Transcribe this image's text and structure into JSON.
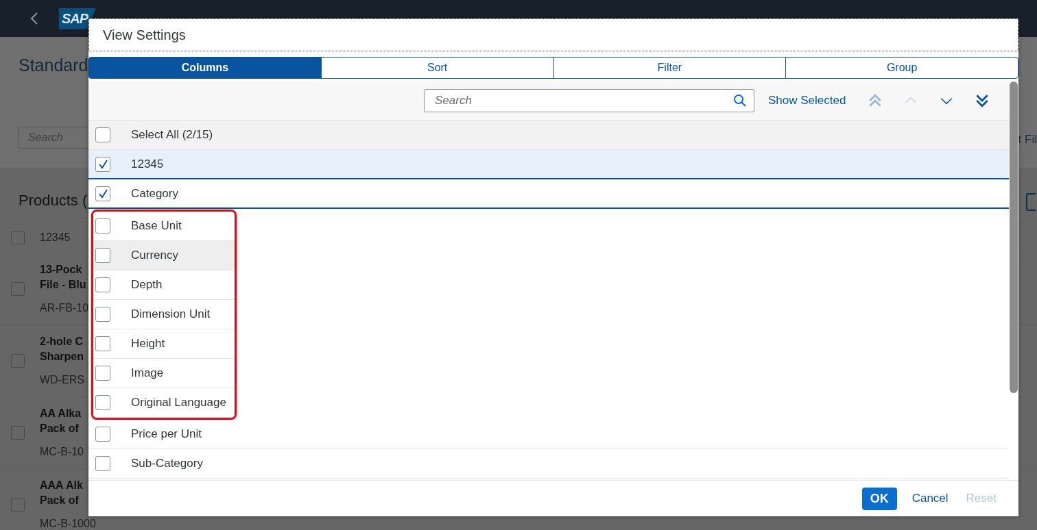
{
  "shell": {
    "logo": "SAP"
  },
  "page": {
    "title": "Standard",
    "search": {
      "placeholder": "Search"
    },
    "side_text": "t Fil"
  },
  "products": {
    "title": "Products (",
    "rows": [
      {
        "kind": "plain",
        "checked": false,
        "lines": [
          "12345"
        ]
      },
      {
        "kind": "item",
        "checked": false,
        "lines": [
          "13-Pock",
          "File - Blu",
          "AR-FB-10"
        ]
      },
      {
        "kind": "item",
        "checked": false,
        "lines": [
          "2-hole C",
          "Sharpen",
          "WD-ERS"
        ]
      },
      {
        "kind": "item",
        "checked": false,
        "lines": [
          "AA Alka",
          "Pack of",
          "MC-B-10"
        ]
      },
      {
        "kind": "item",
        "checked": false,
        "lines": [
          "AAA Alk",
          "Pack of",
          "MC-B-1000"
        ]
      }
    ]
  },
  "dialog": {
    "title": "View Settings",
    "tabs": [
      {
        "label": "Columns",
        "selected": true
      },
      {
        "label": "Sort",
        "selected": false
      },
      {
        "label": "Filter",
        "selected": false
      },
      {
        "label": "Group",
        "selected": false
      }
    ],
    "search": {
      "placeholder": "Search"
    },
    "show_selected": "Show Selected",
    "move_buttons": [
      {
        "kind": "top",
        "disabled": true
      },
      {
        "kind": "up",
        "disabled": true
      },
      {
        "kind": "down",
        "disabled": false
      },
      {
        "kind": "bottom",
        "disabled": false
      }
    ],
    "select_all": {
      "label": "Select All (2/15)",
      "checked": false
    },
    "columns": [
      {
        "label": "12345",
        "checked": true,
        "selected": true,
        "hovered": false,
        "marked": false
      },
      {
        "label": "Category",
        "checked": true,
        "selected": false,
        "hovered": false,
        "marked": false
      },
      {
        "label": "Base Unit",
        "checked": false,
        "selected": false,
        "hovered": false,
        "marked": true
      },
      {
        "label": "Currency",
        "checked": false,
        "selected": false,
        "hovered": true,
        "marked": true
      },
      {
        "label": "Depth",
        "checked": false,
        "selected": false,
        "hovered": false,
        "marked": true
      },
      {
        "label": "Dimension Unit",
        "checked": false,
        "selected": false,
        "hovered": false,
        "marked": true
      },
      {
        "label": "Height",
        "checked": false,
        "selected": false,
        "hovered": false,
        "marked": true
      },
      {
        "label": "Image",
        "checked": false,
        "selected": false,
        "hovered": false,
        "marked": true
      },
      {
        "label": "Original Language",
        "checked": false,
        "selected": false,
        "hovered": false,
        "marked": true
      },
      {
        "label": "Price per Unit",
        "checked": false,
        "selected": false,
        "hovered": false,
        "marked": false
      },
      {
        "label": "Sub-Category",
        "checked": false,
        "selected": false,
        "hovered": false,
        "marked": false
      }
    ],
    "buttons": [
      {
        "label": "OK",
        "kind": "emphasized",
        "disabled": false
      },
      {
        "label": "Cancel",
        "kind": "transparent",
        "disabled": false
      },
      {
        "label": "Reset",
        "kind": "transparent",
        "disabled": true
      }
    ]
  }
}
